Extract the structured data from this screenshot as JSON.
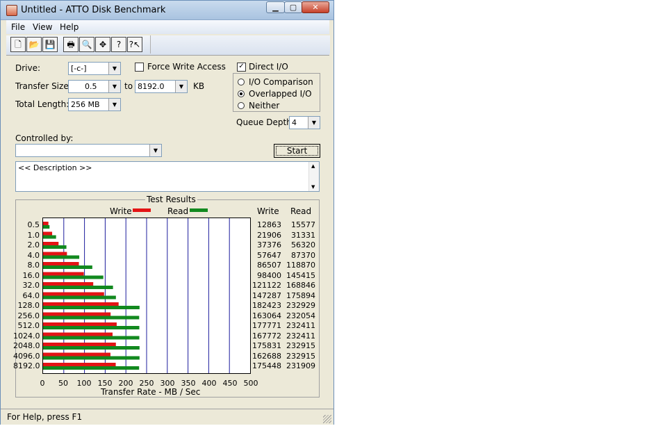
{
  "window": {
    "title": "Untitled - ATTO Disk Benchmark",
    "min_glyph": "▁",
    "max_glyph": "▢",
    "close_glyph": "✕"
  },
  "menu": [
    "File",
    "View",
    "Help"
  ],
  "toolbar": [
    "new-icon",
    "open-icon",
    "save-icon",
    "print-icon",
    "print-preview-icon",
    "move-icon",
    "help-icon",
    "context-help-icon"
  ],
  "form": {
    "drive_label": "Drive:",
    "drive_value": "[-c-]",
    "force_write_label": "Force Write Access",
    "direct_io_label": "Direct I/O",
    "transfer_size_label": "Transfer Size:",
    "transfer_from": "0.5",
    "to_label": "to",
    "transfer_to": "8192.0",
    "kb_label": "KB",
    "total_length_label": "Total Length:",
    "total_length_value": "256 MB",
    "io_comparison_label": "I/O Comparison",
    "overlapped_io_label": "Overlapped I/O",
    "neither_label": "Neither",
    "queue_depth_label": "Queue Depth:",
    "queue_depth_value": "4",
    "controlled_by_label": "Controlled by:",
    "controlled_by_value": "",
    "start_label": "Start",
    "description_text": "<< Description >>"
  },
  "results": {
    "title": "Test Results",
    "write_legend": "Write",
    "read_legend": "Read",
    "write_header": "Write",
    "read_header": "Read",
    "xlabel": "Transfer Rate - MB / Sec"
  },
  "colors": {
    "write": "#e31414",
    "read": "#12891f",
    "grid": "#1c1c9c"
  },
  "chart_data": {
    "type": "bar",
    "categories": [
      "0.5",
      "1.0",
      "2.0",
      "4.0",
      "8.0",
      "16.0",
      "32.0",
      "64.0",
      "128.0",
      "256.0",
      "512.0",
      "1024.0",
      "2048.0",
      "4096.0",
      "8192.0"
    ],
    "xlim": [
      0,
      500
    ],
    "xticks": [
      0,
      50,
      100,
      150,
      200,
      250,
      300,
      350,
      400,
      450,
      500
    ],
    "xlabel": "Transfer Rate - MB / Sec",
    "series": [
      {
        "name": "Write",
        "values": [
          12863,
          21906,
          37376,
          57647,
          86507,
          98400,
          121122,
          147287,
          182423,
          163064,
          177771,
          167772,
          175831,
          162688,
          175448
        ]
      },
      {
        "name": "Read",
        "values": [
          15577,
          31331,
          56320,
          87370,
          118870,
          145415,
          168846,
          175894,
          232929,
          232054,
          232411,
          232411,
          232915,
          232915,
          231909
        ]
      }
    ]
  },
  "status": {
    "text": "For Help, press F1"
  }
}
